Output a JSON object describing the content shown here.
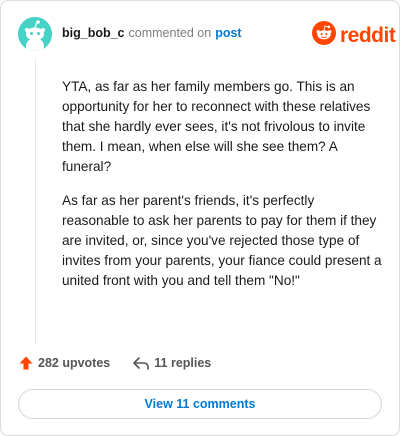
{
  "comment": {
    "username": "big_bob_c",
    "action_text": "commented on",
    "target_link": "post",
    "paragraphs": [
      "YTA, as far as her family members go. This is an opportunity for her to reconnect with these relatives that she hardly ever sees, it's not frivolous to invite them. I mean, when else will she see them? A funeral?",
      "As far as her parent's friends, it's perfectly reasonable to ask her parents to pay for them if they are invited, or, since you've rejected those type of invites from your parents, your fiance could present a united front with you and tell them \"No!\""
    ]
  },
  "brand": {
    "wordmark": "reddit",
    "color": "#ff4500"
  },
  "actions": {
    "upvotes_label": "282 upvotes",
    "replies_label": "11 replies"
  },
  "footer": {
    "view_comments_label": "View 11 comments"
  },
  "colors": {
    "avatar_bg": "#46d2c7",
    "link": "#0079d3",
    "upvote": "#ff4500"
  },
  "icons": [
    "snoo-avatar-icon",
    "reddit-logo-icon",
    "upvote-arrow-icon",
    "reply-arrow-icon"
  ]
}
